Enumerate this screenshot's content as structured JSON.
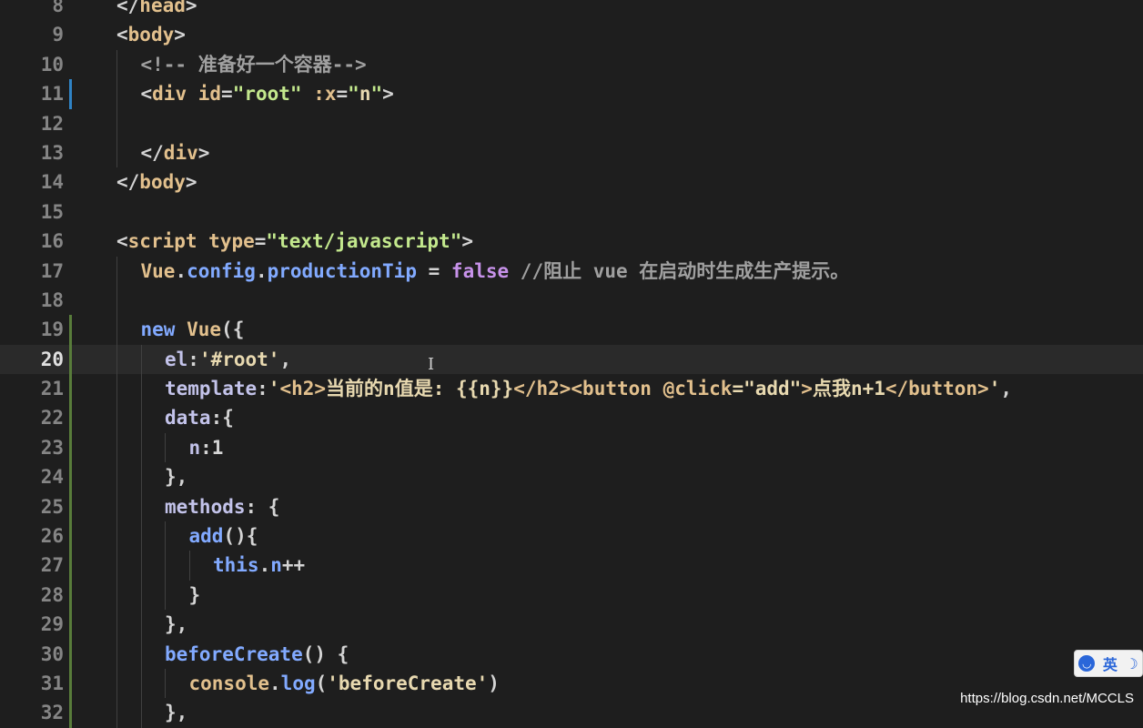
{
  "lines": [
    {
      "n": "8",
      "segs": [
        [
          "t-tag",
          "</"
        ],
        [
          "t-name",
          "head"
        ],
        [
          "t-tag",
          ">"
        ]
      ],
      "indent": 0
    },
    {
      "n": "9",
      "segs": [
        [
          "t-tag",
          "<"
        ],
        [
          "t-name",
          "body"
        ],
        [
          "t-tag",
          ">"
        ]
      ],
      "indent": 0
    },
    {
      "n": "10",
      "segs": [
        [
          "t-cmt",
          "<!-- 准备好一个容器-->"
        ]
      ],
      "indent": 1
    },
    {
      "n": "11",
      "segs": [
        [
          "t-tag",
          "<"
        ],
        [
          "t-name",
          "div"
        ],
        [
          "t-plain",
          " "
        ],
        [
          "t-attr",
          "id"
        ],
        [
          "t-tag",
          "="
        ],
        [
          "t-str",
          "\"root\""
        ],
        [
          "t-plain",
          " "
        ],
        [
          "t-attr",
          ":x"
        ],
        [
          "t-tag",
          "="
        ],
        [
          "t-str",
          "\""
        ],
        [
          "t-strq",
          "n"
        ],
        [
          "t-str",
          "\""
        ],
        [
          "t-tag",
          ">"
        ]
      ],
      "indent": 1
    },
    {
      "n": "12",
      "segs": [],
      "indent": 1
    },
    {
      "n": "13",
      "segs": [
        [
          "t-tag",
          "</"
        ],
        [
          "t-name",
          "div"
        ],
        [
          "t-tag",
          ">"
        ]
      ],
      "indent": 1
    },
    {
      "n": "14",
      "segs": [
        [
          "t-tag",
          "</"
        ],
        [
          "t-name",
          "body"
        ],
        [
          "t-tag",
          ">"
        ]
      ],
      "indent": 0
    },
    {
      "n": "15",
      "segs": [],
      "indent": 0
    },
    {
      "n": "16",
      "segs": [
        [
          "t-tag",
          "<"
        ],
        [
          "t-name",
          "script"
        ],
        [
          "t-plain",
          " "
        ],
        [
          "t-attr",
          "type"
        ],
        [
          "t-tag",
          "="
        ],
        [
          "t-str",
          "\"text/javascript\""
        ],
        [
          "t-tag",
          ">"
        ]
      ],
      "indent": 0
    },
    {
      "n": "17",
      "segs": [
        [
          "t-name",
          "Vue"
        ],
        [
          "t-plain",
          "."
        ],
        [
          "t-fn",
          "config"
        ],
        [
          "t-plain",
          "."
        ],
        [
          "t-fn",
          "productionTip"
        ],
        [
          "t-plain",
          " = "
        ],
        [
          "t-kw",
          "false"
        ],
        [
          "t-plain",
          " "
        ],
        [
          "t-cmt",
          "//阻止 vue 在启动时生成生产提示。"
        ]
      ],
      "indent": 1
    },
    {
      "n": "18",
      "segs": [],
      "indent": 1
    },
    {
      "n": "19",
      "segs": [
        [
          "t-fn",
          "new"
        ],
        [
          "t-plain",
          " "
        ],
        [
          "t-name",
          "Vue"
        ],
        [
          "t-plain",
          "("
        ],
        [
          "t-plain",
          "{"
        ]
      ],
      "indent": 1
    },
    {
      "n": "20",
      "segs": [
        [
          "t-prop",
          "el"
        ],
        [
          "t-plain",
          ":"
        ],
        [
          "t-strq",
          "'#root'"
        ],
        [
          "t-plain",
          ","
        ]
      ],
      "indent": 2,
      "current": true
    },
    {
      "n": "21",
      "segs": [
        [
          "t-prop",
          "template"
        ],
        [
          "t-plain",
          ":"
        ],
        [
          "t-strq",
          "'"
        ],
        [
          "t-html",
          "<h2>"
        ],
        [
          "t-strq",
          "当前的n值是: {{n}}"
        ],
        [
          "t-html",
          "</h2><button"
        ],
        [
          "t-plain",
          " "
        ],
        [
          "t-html",
          "@click"
        ],
        [
          "t-strq",
          "=\"add\""
        ],
        [
          "t-html",
          ">"
        ],
        [
          "t-strq",
          "点我n+1"
        ],
        [
          "t-html",
          "</button>"
        ],
        [
          "t-strq",
          "'"
        ],
        [
          "t-plain",
          ","
        ]
      ],
      "indent": 2
    },
    {
      "n": "22",
      "segs": [
        [
          "t-prop",
          "data"
        ],
        [
          "t-plain",
          ":{"
        ]
      ],
      "indent": 2
    },
    {
      "n": "23",
      "segs": [
        [
          "t-prop",
          "n"
        ],
        [
          "t-plain",
          ":1"
        ]
      ],
      "indent": 3
    },
    {
      "n": "24",
      "segs": [
        [
          "t-plain",
          "},"
        ]
      ],
      "indent": 2
    },
    {
      "n": "25",
      "segs": [
        [
          "t-prop",
          "methods"
        ],
        [
          "t-plain",
          ": {"
        ]
      ],
      "indent": 2
    },
    {
      "n": "26",
      "segs": [
        [
          "t-fn",
          "add"
        ],
        [
          "t-plain",
          "(){"
        ]
      ],
      "indent": 3
    },
    {
      "n": "27",
      "segs": [
        [
          "t-fn",
          "this"
        ],
        [
          "t-plain",
          "."
        ],
        [
          "t-fn",
          "n"
        ],
        [
          "t-plain",
          "++"
        ]
      ],
      "indent": 4
    },
    {
      "n": "28",
      "segs": [
        [
          "t-plain",
          "}"
        ]
      ],
      "indent": 3
    },
    {
      "n": "29",
      "segs": [
        [
          "t-plain",
          "},"
        ]
      ],
      "indent": 2
    },
    {
      "n": "30",
      "segs": [
        [
          "t-fn",
          "beforeCreate"
        ],
        [
          "t-plain",
          "() {"
        ]
      ],
      "indent": 2
    },
    {
      "n": "31",
      "segs": [
        [
          "t-name",
          "console"
        ],
        [
          "t-plain",
          "."
        ],
        [
          "t-fn",
          "log"
        ],
        [
          "t-plain",
          "("
        ],
        [
          "t-strq",
          "'beforeCreate'"
        ],
        [
          "t-plain",
          ")"
        ]
      ],
      "indent": 3
    },
    {
      "n": "32",
      "segs": [
        [
          "t-plain",
          "},"
        ]
      ],
      "indent": 2
    }
  ],
  "ime": {
    "label": "英"
  },
  "watermark": "https://blog.csdn.net/MCCLS"
}
